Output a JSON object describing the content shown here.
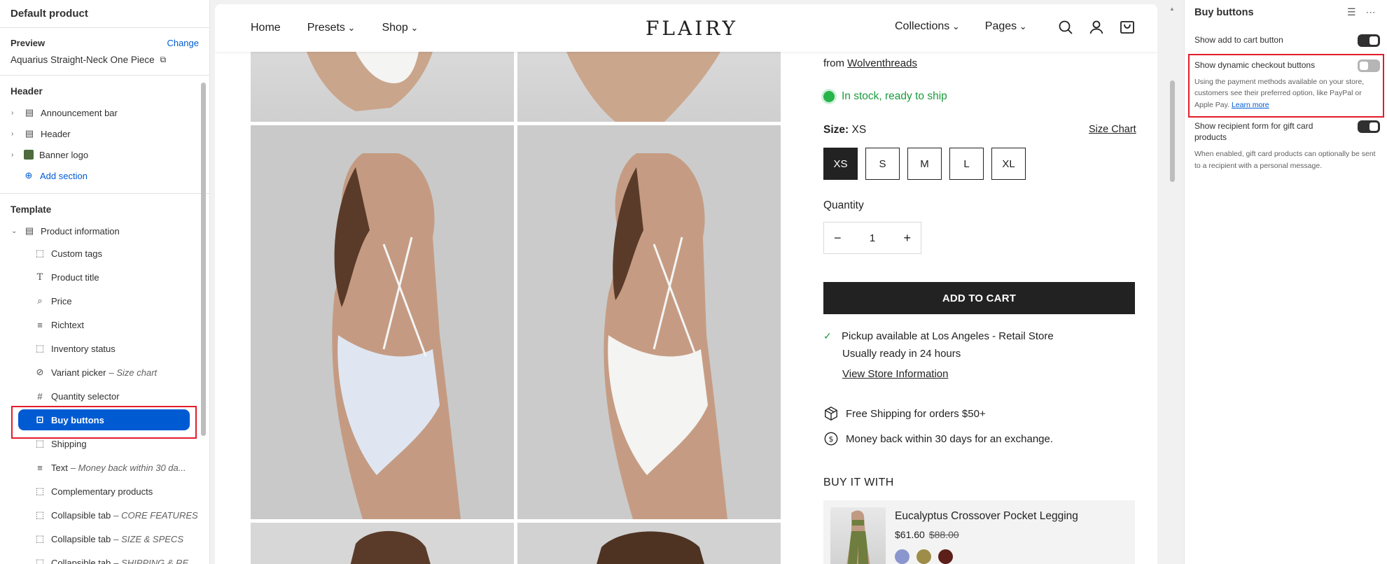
{
  "sidebar": {
    "title": "Default product",
    "preview": {
      "label": "Preview",
      "change": "Change",
      "product": "Aquarius Straight-Neck One Piece"
    },
    "header_section": "Header",
    "header_items": [
      "Announcement bar",
      "Header",
      "Banner logo"
    ],
    "add_section": "Add section",
    "template_section": "Template",
    "product_information": "Product information",
    "blocks": [
      {
        "label": "Custom tags",
        "sub": ""
      },
      {
        "label": "Product title",
        "sub": ""
      },
      {
        "label": "Price",
        "sub": ""
      },
      {
        "label": "Richtext",
        "sub": ""
      },
      {
        "label": "Inventory status",
        "sub": ""
      },
      {
        "label": "Variant picker",
        "sub": "– Size chart"
      },
      {
        "label": "Quantity selector",
        "sub": ""
      },
      {
        "label": "Buy buttons",
        "sub": ""
      },
      {
        "label": "Shipping",
        "sub": ""
      },
      {
        "label": "Text",
        "sub": "– Money back within 30 da..."
      },
      {
        "label": "Complementary products",
        "sub": ""
      },
      {
        "label": "Collapsible tab",
        "sub": "– CORE FEATURES"
      },
      {
        "label": "Collapsible tab",
        "sub": "– SIZE & SPECS"
      },
      {
        "label": "Collapsible tab",
        "sub": "– SHIPPING & RE..."
      }
    ]
  },
  "store": {
    "nav": {
      "home": "Home",
      "presets": "Presets",
      "shop": "Shop",
      "logo": "FLAIRY",
      "collections": "Collections",
      "pages": "Pages"
    },
    "from_prefix": "from",
    "vendor": "Wolventhreads",
    "stock": "In stock, ready to ship",
    "size_label": "Size:",
    "size_value": "XS",
    "size_chart": "Size Chart",
    "sizes": [
      "XS",
      "S",
      "M",
      "L",
      "XL"
    ],
    "quantity_label": "Quantity",
    "quantity_value": "1",
    "add_to_cart": "ADD TO CART",
    "pickup_line1": "Pickup available at Los Angeles - Retail Store",
    "pickup_line2": "Usually ready in 24 hours",
    "store_info": "View Store Information",
    "perk1": "Free Shipping for orders $50+",
    "perk2": "Money back within 30 days for an exchange.",
    "buy_it_with": "BUY IT WITH",
    "rec": {
      "title": "Eucalyptus Crossover Pocket Legging",
      "price": "$61.60",
      "compare": "$88.00",
      "swatches": [
        "#8b96cf",
        "#9d8d49",
        "#5c1f1a"
      ]
    }
  },
  "settings": {
    "title": "Buy buttons",
    "add_to_cart": {
      "label": "Show add to cart button",
      "on": true
    },
    "dynamic_checkout": {
      "label": "Show dynamic checkout buttons",
      "on": false,
      "help": "Using the payment methods available on your store, customers see their preferred option, like PayPal or Apple Pay.",
      "learn_more": "Learn more"
    },
    "gift_card": {
      "label": "Show recipient form for gift card products",
      "on": true,
      "help": "When enabled, gift card products can optionally be sent to a recipient with a personal message."
    }
  },
  "colors": {
    "accent": "#005bd3",
    "highlight": "#e11d2a",
    "in_stock": "#1a9b3c",
    "dark": "#222222"
  }
}
